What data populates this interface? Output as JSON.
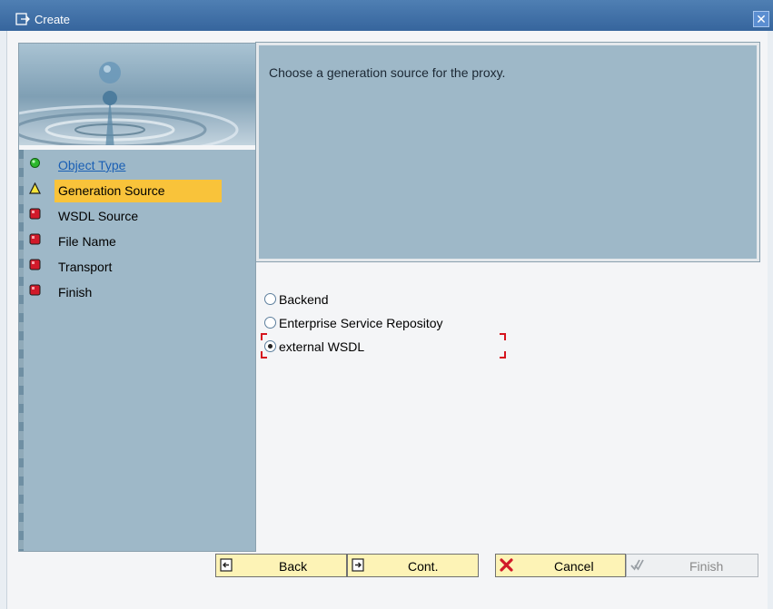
{
  "window": {
    "title": "Create",
    "close_glyph": "✕"
  },
  "roadmap": {
    "steps": [
      {
        "label": "Object Type",
        "status": "done",
        "icon": "green-circle-icon"
      },
      {
        "label": "Generation Source",
        "status": "current",
        "icon": "yellow-triangle-icon"
      },
      {
        "label": "WSDL Source",
        "status": "pending",
        "icon": "red-square-icon"
      },
      {
        "label": "File Name",
        "status": "pending",
        "icon": "red-square-icon"
      },
      {
        "label": "Transport",
        "status": "pending",
        "icon": "red-square-icon"
      },
      {
        "label": "Finish",
        "status": "pending",
        "icon": "red-square-icon"
      }
    ]
  },
  "info": {
    "text": "Choose a generation source for the proxy."
  },
  "options": [
    {
      "label": "Backend",
      "checked": false
    },
    {
      "label": "Enterprise Service Repositoy",
      "checked": false
    },
    {
      "label": "external WSDL",
      "checked": true
    }
  ],
  "buttons": {
    "back": "Back",
    "cont": "Cont.",
    "cancel": "Cancel",
    "finish": "Finish"
  },
  "colors": {
    "titlebar": "#36659d",
    "panel": "#9eb8c8",
    "active_step": "#f9c33a",
    "button": "#fdf3b6",
    "status_done": "#2db82d",
    "status_current": "#f4e33a",
    "status_pending": "#d11a2a"
  }
}
